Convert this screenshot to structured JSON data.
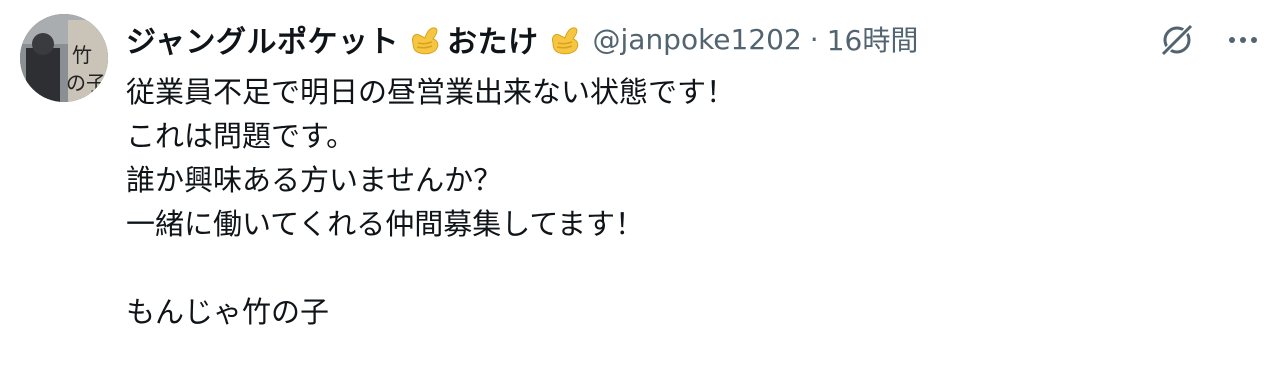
{
  "tweet": {
    "display_name_part1": "ジャングルポケット",
    "display_name_part2": "おたけ",
    "emoji_name": "call-me-hand-emoji",
    "handle": "@janpoke1202",
    "separator": "·",
    "timestamp": "16時間",
    "lines": [
      "従業員不足で明日の昼営業出来ない状態です！",
      "これは問題です。",
      "誰か興味ある方いませんか？",
      "一緒に働いてくれる仲間募集してます！",
      "",
      "もんじゃ竹の子"
    ]
  },
  "icons": {
    "grok": "grok-icon",
    "more": "more-horizontal-icon"
  },
  "colors": {
    "text_primary": "#0f1419",
    "text_secondary": "#536471",
    "emoji_skin": "#f6c643"
  }
}
